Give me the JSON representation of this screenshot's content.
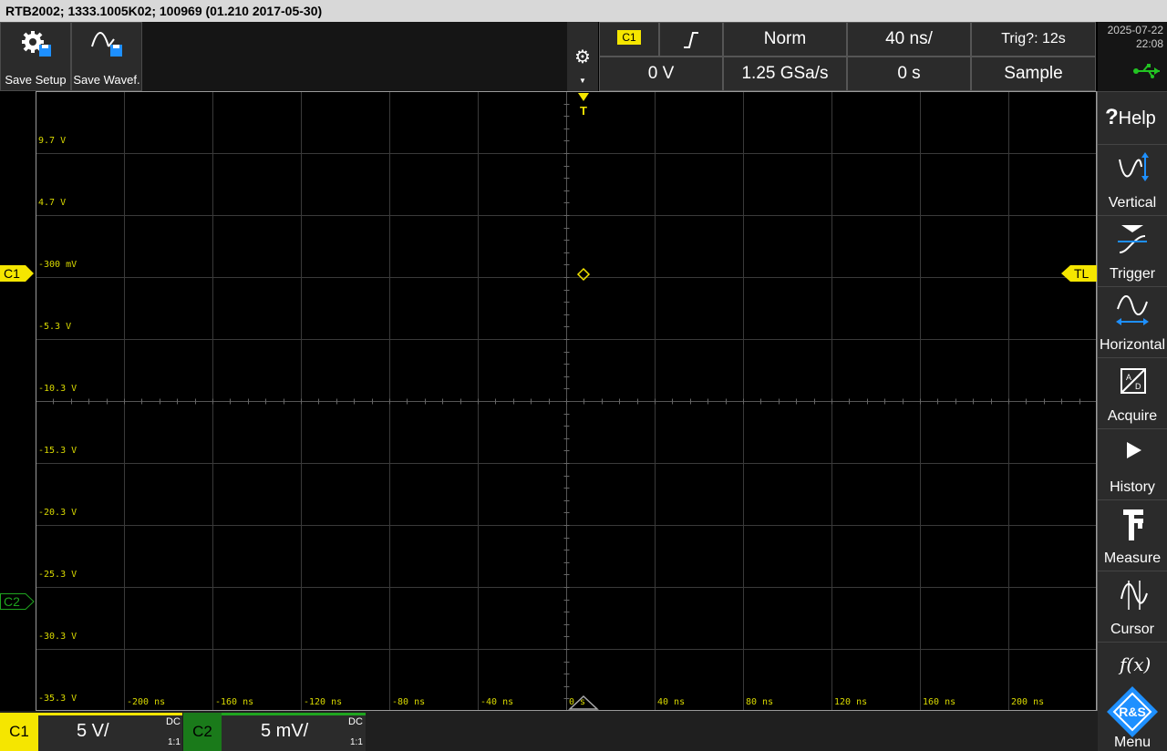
{
  "title": "RTB2002; 1333.1005K02; 100969 (01.210 2017-05-30)",
  "toolbar": {
    "save_setup": "Save Setup",
    "save_waveform": "Save Wavef."
  },
  "trigger_info": {
    "source": "C1",
    "slope_icon": "rising-edge-icon",
    "mode": "Norm",
    "timebase": "40 ns/",
    "status": "Trig?: 12s",
    "level": "0 V",
    "sample_rate": "1.25 GSa/s",
    "position": "0 s",
    "acq_mode": "Sample"
  },
  "datetime": {
    "date": "2025-07-22",
    "time": "22:08"
  },
  "grid": {
    "y_labels": [
      "9.7 V",
      "4.7 V",
      "-300 mV",
      "-5.3 V",
      "-10.3 V",
      "-15.3 V",
      "-20.3 V",
      "-25.3 V",
      "-30.3 V",
      "-35.3 V"
    ],
    "x_labels": [
      "-200 ns",
      "-160 ns",
      "-120 ns",
      "-80 ns",
      "-40 ns",
      "0 s",
      "40 ns",
      "80 ns",
      "120 ns",
      "160 ns",
      "200 ns"
    ],
    "trigger_marker": "T",
    "trigger_level_marker": "TL",
    "ch1_marker": "C1",
    "ch2_marker": "C2"
  },
  "side_menu": [
    {
      "label": "Help",
      "icon": "question-icon"
    },
    {
      "label": "Vertical",
      "icon": "vertical-icon"
    },
    {
      "label": "Trigger",
      "icon": "trigger-icon"
    },
    {
      "label": "Horizontal",
      "icon": "horizontal-icon"
    },
    {
      "label": "Acquire",
      "icon": "acquire-icon"
    },
    {
      "label": "History",
      "icon": "play-icon"
    },
    {
      "label": "Measure",
      "icon": "caliper-icon"
    },
    {
      "label": "Cursor",
      "icon": "cursor-icon"
    },
    {
      "label": "Menu",
      "icon": "fx-icon",
      "fx": "f(x)",
      "logo": "R&S"
    }
  ],
  "channels": [
    {
      "name": "C1",
      "scale": "5 V/",
      "coupling": "DC",
      "probe": "1:1",
      "color": "#f5e600"
    },
    {
      "name": "C2",
      "scale": "5 mV/",
      "coupling": "DC",
      "probe": "1:1",
      "color": "#1fa51f"
    }
  ],
  "colors": {
    "ch1": "#f5e600",
    "ch2": "#1fa51f",
    "usb": "#22c422",
    "accent": "#1e90ff"
  }
}
